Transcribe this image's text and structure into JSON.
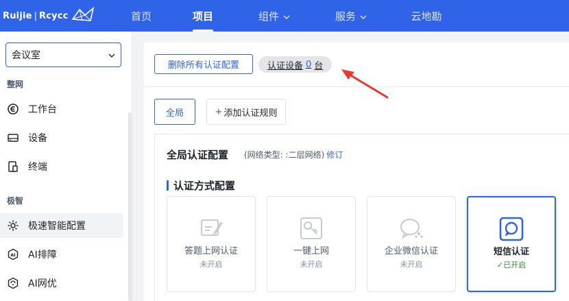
{
  "brand": {
    "name_left": "Ruijie",
    "separator": "|",
    "name_right": "Rcycc"
  },
  "nav": {
    "items": [
      {
        "label": "首页",
        "dropdown": false,
        "active": false
      },
      {
        "label": "项目",
        "dropdown": false,
        "active": true
      },
      {
        "label": "组件",
        "dropdown": true,
        "active": false
      },
      {
        "label": "服务",
        "dropdown": true,
        "active": false
      },
      {
        "label": "云地勘",
        "dropdown": false,
        "active": false
      }
    ]
  },
  "sidebar": {
    "site_select": {
      "value": "会议室"
    },
    "groups": [
      {
        "label": "整网",
        "items": [
          {
            "label": "工作台",
            "icon": "dashboard-icon"
          },
          {
            "label": "设备",
            "icon": "device-icon"
          },
          {
            "label": "终端",
            "icon": "terminal-icon"
          }
        ]
      },
      {
        "label": "极智",
        "items": [
          {
            "label": "极速智能配置",
            "icon": "smart-config-icon",
            "active": true
          },
          {
            "label": "AI排障",
            "icon": "ai-troubleshoot-icon"
          },
          {
            "label": "AI网优",
            "icon": "ai-optimize-icon"
          }
        ]
      }
    ]
  },
  "main": {
    "delete_all_button": "删除所有认证配置",
    "device_count": {
      "prefix": "认证设备",
      "count": "0",
      "unit": "台"
    },
    "tabs": {
      "global": "全局",
      "add_rule": "添加认证规则"
    },
    "config_title": "全局认证配置",
    "network_type": "(网络类型: :二层网络)",
    "edit_link": "修订",
    "section_title": "认证方式配置",
    "auth_cards": [
      {
        "name": "答题上网认证",
        "status": "未开启",
        "icon": "quiz-auth-icon",
        "enabled": false
      },
      {
        "name": "一键上网",
        "status": "未开启",
        "icon": "one-click-icon",
        "enabled": false
      },
      {
        "name": "企业微信认证",
        "status": "未开启",
        "icon": "wecom-icon",
        "enabled": false
      },
      {
        "name": "短信认证",
        "status": "已开启",
        "icon": "sms-icon",
        "enabled": true
      }
    ]
  },
  "colors": {
    "primary": "#2f63e8",
    "annotation_arrow": "#e8392b",
    "enabled_green": "#2f8a3b"
  }
}
